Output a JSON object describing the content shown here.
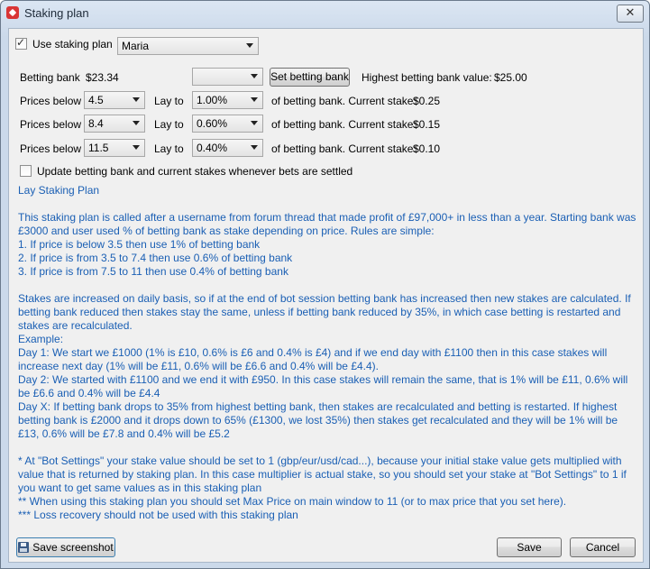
{
  "window": {
    "title": "Staking plan",
    "close_label": "✕"
  },
  "use_staking_plan": {
    "label": "Use staking plan",
    "checked": true,
    "selected": "Maria"
  },
  "betting_bank": {
    "label": "Betting bank",
    "value": "$23.34",
    "combo_value": "",
    "set_button": "Set betting bank",
    "highest_label": "Highest betting bank value:",
    "highest_value": "$25.00"
  },
  "rules": [
    {
      "prices_below_label": "Prices below",
      "price": "4.5",
      "lay_to_label": "Lay to",
      "percent": "1.00%",
      "suffix": "of betting bank. Current stake:",
      "stake": "$0.25"
    },
    {
      "prices_below_label": "Prices below",
      "price": "8.4",
      "lay_to_label": "Lay to",
      "percent": "0.60%",
      "suffix": "of betting bank. Current stake:",
      "stake": "$0.15"
    },
    {
      "prices_below_label": "Prices below",
      "price": "11.5",
      "lay_to_label": "Lay to",
      "percent": "0.40%",
      "suffix": "of betting bank. Current stake:",
      "stake": "$0.10"
    }
  ],
  "update_checkbox": {
    "label": "Update betting bank and current stakes whenever bets are settled",
    "checked": false
  },
  "plan_title": "Lay Staking Plan",
  "description": [
    "This staking plan is called after a username from forum thread that made profit of £97,000+ in less than a year. Starting bank was £3000 and user used % of betting bank as stake depending on price. Rules are simple:",
    "1. If price is below 3.5 then use 1% of betting bank",
    "2. If price is from 3.5 to 7.4 then use 0.6% of betting bank",
    "3. If price is from 7.5 to 11 then use 0.4% of betting bank",
    "",
    "Stakes are increased on daily basis, so if at the end of bot session betting bank has increased then new stakes are calculated. If betting bank reduced then stakes stay the same, unless if betting bank reduced by 35%, in which case betting is restarted and stakes are recalculated.",
    "Example:",
    "Day 1: We start we £1000 (1% is £10, 0.6% is £6 and 0.4% is £4) and if we end day with £1100 then in this case stakes will increase next day (1% will be £11, 0.6% will be £6.6 and 0.4% will be £4.4).",
    "Day 2: We started with £1100 and we end it with £950. In this case stakes will remain the same, that is 1% will be £11, 0.6% will be £6.6 and 0.4% will be £4.4",
    "Day X: If betting bank drops to 35% from highest betting bank, then stakes are recalculated and betting is restarted. If highest betting bank is £2000 and it drops down to 65% (£1300, we lost 35%) then stakes get recalculated and they will be 1% will be £13, 0.6% will be £7.8 and 0.4% will be £5.2",
    "",
    "* At \"Bot Settings\" your stake value should be set to 1 (gbp/eur/usd/cad...), because your initial stake value gets multiplied with value that is returned by staking plan. In this case multiplier is actual stake, so you should set your stake at \"Bot Settings\" to 1 if you want to get same values as in this staking plan",
    "** When using this staking plan you should set Max Price on main window to 11 (or to max price that you set here).",
    "*** Loss recovery should not be used with this staking plan"
  ],
  "footer": {
    "screenshot_button": "Save screenshot",
    "save_button": "Save",
    "cancel_button": "Cancel"
  },
  "colors": {
    "link_blue": "#1a5fb4",
    "dialog_bg": "#f0f0f0",
    "title_bg": "#cbd9ea"
  }
}
